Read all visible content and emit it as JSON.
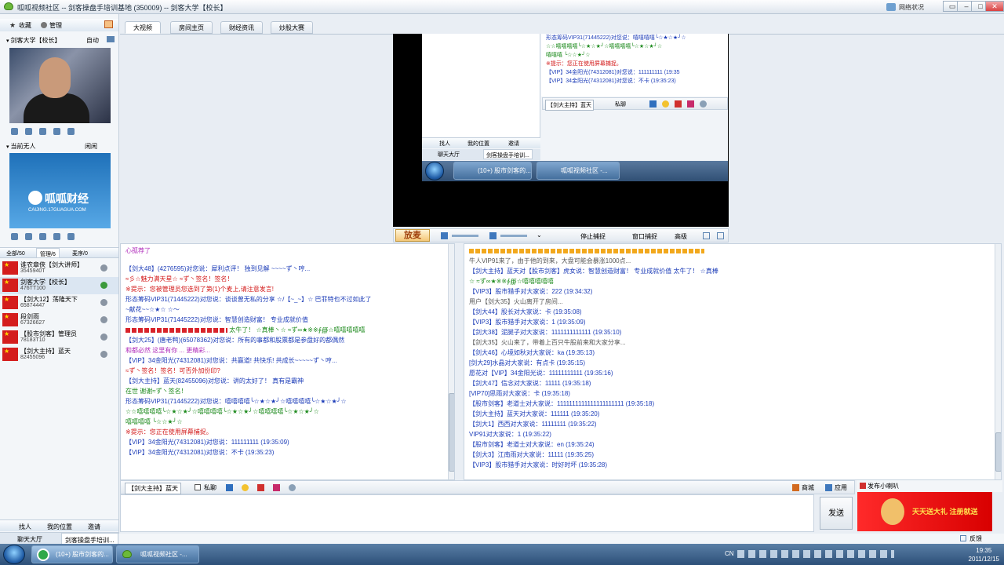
{
  "window": {
    "title": "呱呱视频社区 -- 剑客操盘手培训基地 (350009) -- 剑客大学【校长】",
    "network": "网络状况",
    "controls": [
      "▭",
      "–",
      "□",
      "✕"
    ]
  },
  "left": {
    "collect": "收藏",
    "manage": "管理",
    "host_name": "剑客大学【校长】",
    "host_mode": "自动",
    "current": "当前无人",
    "current_mode": "闲闲",
    "logo_text": "呱呱财经",
    "logo_sub": "CAIJING.17GUAGUA.COM",
    "list_tabs": [
      "全部/50",
      "管理/6",
      "麦序/0"
    ],
    "users": [
      {
        "name": "谁农章俠【剑大讲师】",
        "id": "3545940T"
      },
      {
        "name": "剑客大学【校长】",
        "id": "476TT100"
      },
      {
        "name": "【剑大12】荡隆天下",
        "id": "65874447"
      },
      {
        "name": "段剑雨",
        "id": "67326627"
      },
      {
        "name": "【股市剑客】管理员",
        "id": "78183T10"
      },
      {
        "name": "【剑大主持】蓝天",
        "id": "82455096"
      }
    ],
    "bottom_tabs": [
      "找人",
      "我的位置",
      "邀请"
    ],
    "bottom_tabs2": [
      "聊天大厅",
      "剑客操盘手培训..."
    ]
  },
  "main_tabs": [
    "大视频",
    "房间主页",
    "财经资讯",
    "炒股大赛"
  ],
  "inner": {
    "lines": [
      {
        "t": "形态筹码VIP31(71445222)对您说：嘻嘻嘻嘻╰☆★☆★╯☆",
        "c": "blue"
      },
      {
        "t": "☆☆嘻嘻嘻嘻╰☆★☆★╯☆嘻嘻嘻嘻╰☆★☆★╯☆",
        "c": "green"
      },
      {
        "t": "嘻嘻嘻 ╰☆☆★╯☆",
        "c": "green"
      },
      {
        "t": "※提示：您正在使用屏幕捕捉。",
        "c": "red"
      },
      {
        "t": "【VIP】34金阳光(74312081)对您说：111111111 (19:35",
        "c": "blue"
      },
      {
        "t": "【VIP】34金阳光(74312081)对您说：不卡 (19:35:23)",
        "c": "blue"
      }
    ],
    "input_target": "【剑大主持】蓝天",
    "private": "私聊",
    "bottom": [
      "找人",
      "我的位置",
      "邀请"
    ],
    "bottom2": [
      "聊天大厅",
      "剑客操盘手培训..."
    ],
    "task1": "(10+) 股市剑客的...",
    "task2": "呱呱视频社区 -..."
  },
  "controls": {
    "mic": "放麦",
    "stop_capture": "停止捕捉",
    "window_capture": "窗口捕捉",
    "quality": "高级"
  },
  "left_chat": [
    {
      "t": "心孤荐了",
      "c": "mag"
    },
    {
      "t": "【剑大48】(4276595)对您说：犀利点评！  独到见解 ~~~~ず丶哼...",
      "c": "blue"
    },
    {
      "t": "≈彡☆魅力满天星☆ ≈ず丶签名！签名！",
      "c": "red"
    },
    {
      "t": "※提示：您被管理员您选到了第(1)个麦上,请注意发言!",
      "c": "red"
    },
    {
      "t": "形态筹码VIP31(71445222)对您说：谈谈曾无私的分享  ☆/【~_~】☆  巴菲特也不过如此了",
      "c": "blue"
    },
    {
      "t": "~献花~~☆★☆ ☆～",
      "c": "blue"
    },
    {
      "t": "形态筹码VIP31(71445222)对您说：智慧创造财富！   专业成就价值",
      "c": "blue"
    },
    {
      "t": "太牛了！ ☆真棒丶☆ ≈ず∞★※※∮∰☆嘻嘻嘻嘻嘻",
      "c": "green"
    },
    {
      "t": "【剑大25】(唐老鸭)(65078362)对您说：所有的事都和股票都是参盘好的都偶然",
      "c": "blue"
    },
    {
      "t": "和都必然  这里有你 ... 更精彩...",
      "c": "mag"
    },
    {
      "t": "【VIP】34金阳光(74312081)对您说：共赢道! 共快乐! 共成长~~~~~ず丶哼...",
      "c": "blue"
    },
    {
      "t": "≈ず丶签名！签名！可否外加份印?",
      "c": "red"
    },
    {
      "t": "【剑大主持】蓝天(82455096)对您说：讲的太好了！  真有是霸神",
      "c": "blue"
    },
    {
      "t": "在世  谢谢≈ず丶签名！",
      "c": "green"
    },
    {
      "t": "形态筹码VIP31(71445222)对您说：嘻嘻嘻嘻╰☆★☆★╯☆嘻嘻嘻嘻╰☆★☆★╯☆",
      "c": "blue"
    },
    {
      "t": "☆☆嘻嘻嘻嘻╰☆★☆★╯☆嘻嘻嘻嘻╰☆★☆★╯☆嘻嘻嘻嘻╰☆★☆★╯☆",
      "c": "green"
    },
    {
      "t": "嘻嘻嘻嘻 ╰☆☆★╯☆",
      "c": "green"
    },
    {
      "t": "※提示：您正在使用屏幕捕捉。",
      "c": "red"
    },
    {
      "t": "【VIP】34金阳光(74312081)对您说：111111111 (19:35:09)",
      "c": "blue"
    },
    {
      "t": "【VIP】34金阳光(74312081)对您说：不卡 (19:35:23)",
      "c": "blue"
    }
  ],
  "right_chat": [
    {
      "t": "牛人VIP91来了，由于他的到来，大盘可能会暴涨1000点...",
      "c": "gray"
    },
    {
      "t": "【剑大主持】蓝天对【股市剑客】虎女说：智慧创造财富！  专业成就价值  太牛了！ ☆真棒",
      "c": "blue"
    },
    {
      "t": "☆ ≈ず∞★※※∮∰☆嘻嘻嘻嘻嘻",
      "c": "green"
    },
    {
      "t": "【VIP3】股市猎手对大家说：222 (19:34:32)",
      "c": "blue"
    },
    {
      "t": "用户【剑大35】火山离开了房间...",
      "c": "gray"
    },
    {
      "t": "【剑大44】股长对大家说：卡 (19:35:08)",
      "c": "blue"
    },
    {
      "t": "【VIP3】股市猎手对大家说：1 (19:35:09)",
      "c": "blue"
    },
    {
      "t": "【剑大38】泥腿子对大家说：1111111111111 (19:35:10)",
      "c": "blue"
    },
    {
      "t": "【剑大35】火山来了，带着上百只牛股前来和大家分享...",
      "c": "gray"
    },
    {
      "t": "【剑大46】心境如秋对大家说：ka (19:35:13)",
      "c": "blue"
    },
    {
      "t": "[剑大29]水晶对大家说：有点卡 (19:35:15)",
      "c": "blue"
    },
    {
      "t": "愿花对【VIP】34金阳光说：11111111111 (19:35:16)",
      "c": "blue"
    },
    {
      "t": "【剑大47】信念对大家说：11111 (19:35:18)",
      "c": "blue"
    },
    {
      "t": "[VIP70]思雨对大家说：卡 (19:35:18)",
      "c": "blue"
    },
    {
      "t": "【股市剑客】老道士对大家说：1111111111111111111111 (19:35:18)",
      "c": "blue"
    },
    {
      "t": "【剑大主持】蓝天对大家说：111111 (19:35:20)",
      "c": "blue"
    },
    {
      "t": "【剑大1】西西对大家说：11111111 (19:35:22)",
      "c": "blue"
    },
    {
      "t": "VIP91对大家说：1 (19:35:22)",
      "c": "blue"
    },
    {
      "t": "【股市剑客】老道士对大家说：en (19:35:24)",
      "c": "blue"
    },
    {
      "t": "【剑大3】江南雨对大家说：11111 (19:35:25)",
      "c": "blue"
    },
    {
      "t": "【VIP3】股市猎手对大家说：时好时坏 (19:35:28)",
      "c": "blue"
    }
  ],
  "input_bar": {
    "target": "【剑大主持】蓝天",
    "private": "私聊",
    "mall": "商城",
    "apps": "应用",
    "horn": "发布小喇叭",
    "send": "发送",
    "promo": "天天送大礼 注册就送"
  },
  "taskbar": {
    "item1": "(10+) 股市剑客的...",
    "item2": "呱呱视频社区 -...",
    "lang": "CN",
    "feedback": "反馈",
    "time": "19:35",
    "date": "2011/12/15"
  }
}
